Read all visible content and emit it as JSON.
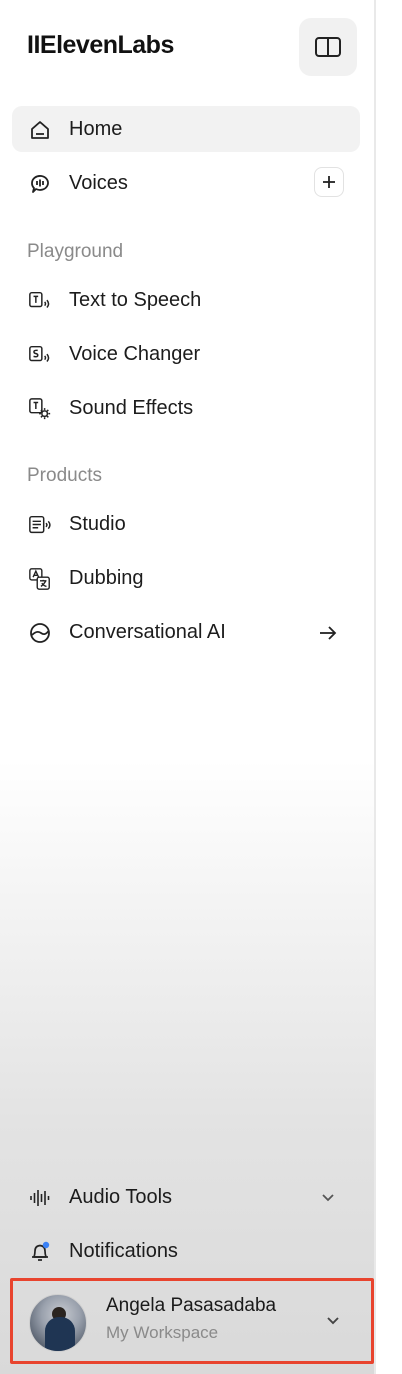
{
  "brand": {
    "logo_text": "IIElevenLabs"
  },
  "nav": {
    "home": "Home",
    "voices": "Voices"
  },
  "sections": {
    "playground": {
      "title": "Playground",
      "items": [
        "Text to Speech",
        "Voice Changer",
        "Sound Effects"
      ]
    },
    "products": {
      "title": "Products",
      "items": [
        "Studio",
        "Dubbing",
        "Conversational AI"
      ]
    }
  },
  "footer": {
    "audio_tools": "Audio Tools",
    "notifications": "Notifications"
  },
  "account": {
    "name": "Angela Pasasadaba",
    "workspace": "My Workspace"
  },
  "icons": {
    "toggle": "sidebar-toggle-icon",
    "home": "home-icon",
    "voices": "voices-icon",
    "add": "plus-icon",
    "arrow": "arrow-right-icon",
    "chevron": "chevron-down-icon",
    "notification_dot_color": "#3b82f6"
  }
}
